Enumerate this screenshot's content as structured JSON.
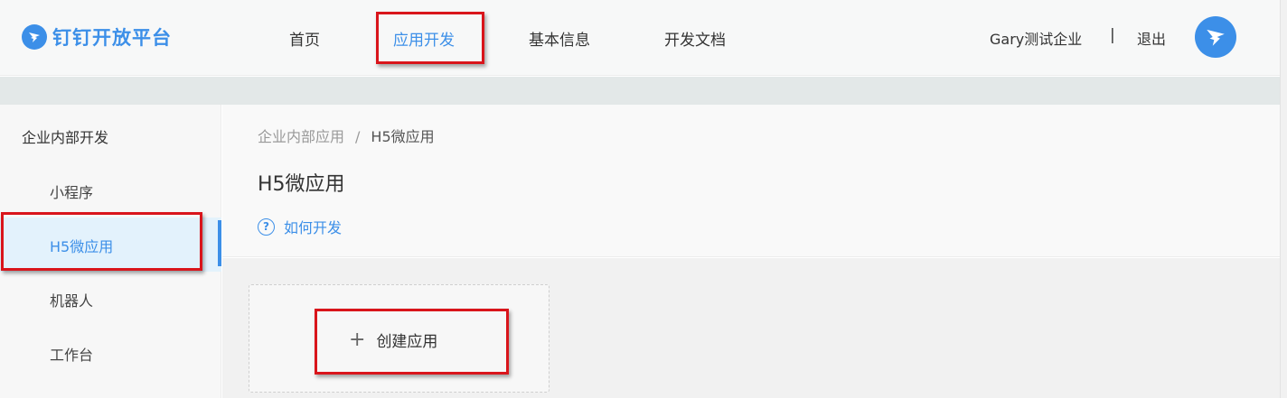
{
  "header": {
    "logo_text": "钉钉开放平台",
    "nav": [
      {
        "label": "首页"
      },
      {
        "label": "应用开发"
      },
      {
        "label": "基本信息"
      },
      {
        "label": "开发文档"
      }
    ],
    "company": "Gary测试企业",
    "separator": "|",
    "logout": "退出"
  },
  "sidebar": {
    "title": "企业内部开发",
    "items": [
      {
        "label": "小程序"
      },
      {
        "label": "H5微应用"
      },
      {
        "label": "机器人"
      },
      {
        "label": "工作台"
      }
    ]
  },
  "main": {
    "breadcrumb": {
      "parent": "企业内部应用",
      "separator": "/",
      "current": "H5微应用"
    },
    "title": "H5微应用",
    "howto_icon": "?",
    "howto": "如何开发",
    "create_icon": "+",
    "create_label": "创建应用"
  },
  "colors": {
    "brand": "#3c8fe8",
    "highlight": "#d9151b"
  }
}
